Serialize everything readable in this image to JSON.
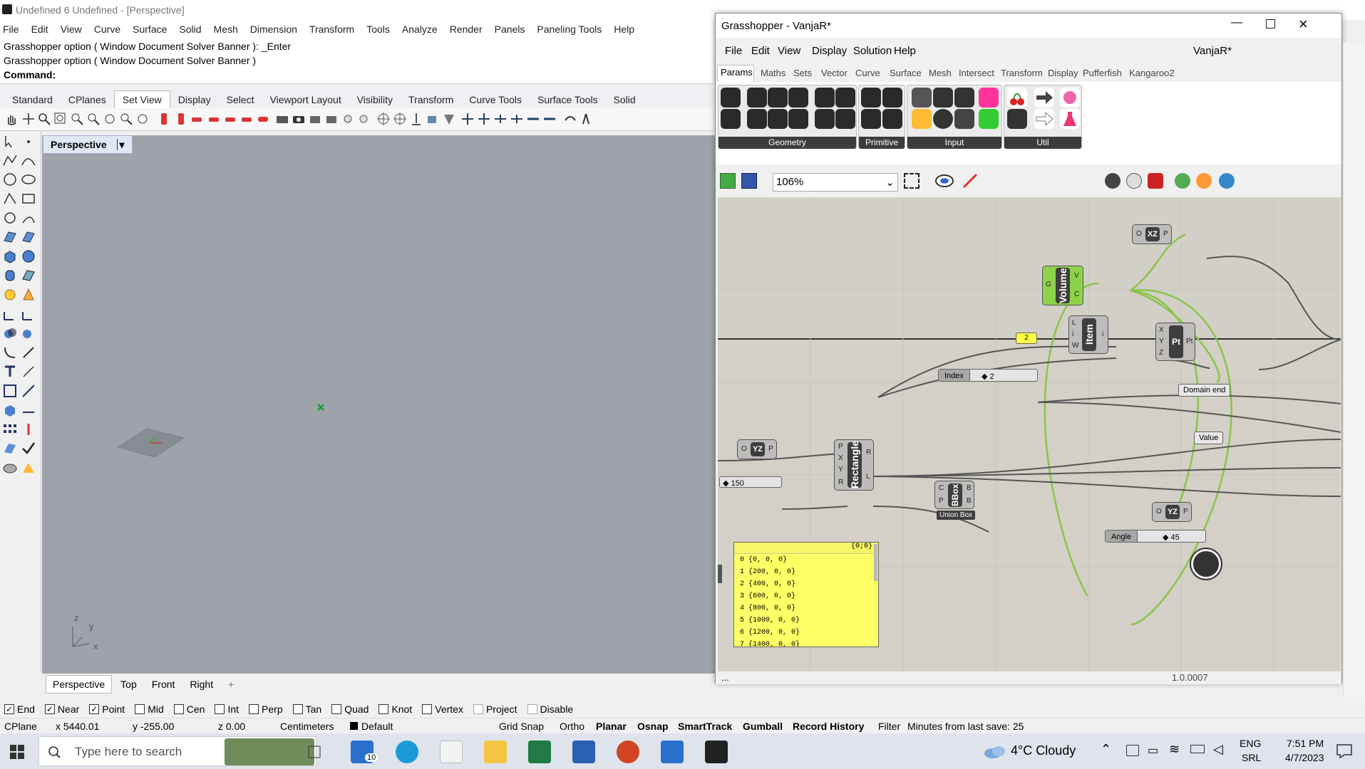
{
  "rhino": {
    "title": "Undefined 6 Undefined - [Perspective]",
    "menu": [
      "File",
      "Edit",
      "View",
      "Curve",
      "Surface",
      "Solid",
      "Mesh",
      "Dimension",
      "Transform",
      "Tools",
      "Analyze",
      "Render",
      "Panels",
      "Paneling Tools",
      "Help"
    ],
    "command_history": [
      "Grasshopper option ( Window  Document  Solver  Banner ): _Enter",
      "Grasshopper option ( Window  Document  Solver  Banner )"
    ],
    "command_prompt": "Command:",
    "toolbar_tabs": [
      "Standard",
      "CPlanes",
      "Set View",
      "Display",
      "Select",
      "Viewport Layout",
      "Visibility",
      "Transform",
      "Curve Tools",
      "Surface Tools",
      "Solid"
    ],
    "active_toolbar_tab": "Set View",
    "viewport_label": "Perspective",
    "axis": {
      "x": "x",
      "y": "y",
      "z": "z"
    },
    "viewport_tabs": [
      "Perspective",
      "Top",
      "Front",
      "Right"
    ],
    "add_tab": "+",
    "osnaps": [
      {
        "label": "End",
        "checked": true
      },
      {
        "label": "Near",
        "checked": true
      },
      {
        "label": "Point",
        "checked": true
      },
      {
        "label": "Mid",
        "checked": false
      },
      {
        "label": "Cen",
        "checked": false
      },
      {
        "label": "Int",
        "checked": false
      },
      {
        "label": "Perp",
        "checked": false
      },
      {
        "label": "Tan",
        "checked": false
      },
      {
        "label": "Quad",
        "checked": false
      },
      {
        "label": "Knot",
        "checked": false
      },
      {
        "label": "Vertex",
        "checked": false
      },
      {
        "label": "Project",
        "checked": false
      },
      {
        "label": "Disable",
        "checked": false
      }
    ],
    "status": {
      "cplane": "CPlane",
      "x": "x 5440.01",
      "y": "y -255.00",
      "z": "z 0.00",
      "units": "Centimeters",
      "layer": "Default",
      "grid_snap": "Grid Snap",
      "ortho": "Ortho",
      "planar": "Planar",
      "osnap": "Osnap",
      "smarttrack": "SmartTrack",
      "gumball": "Gumball",
      "record_history": "Record History",
      "filter": "Filter",
      "minutes": "Minutes from last save: 25"
    }
  },
  "grasshopper": {
    "title": "Grasshopper - VanjaR*",
    "menu": [
      "File",
      "Edit",
      "View",
      "Display",
      "Solution",
      "Help"
    ],
    "doc_name": "VanjaR*",
    "tabs": [
      "Params",
      "Maths",
      "Sets",
      "Vector",
      "Curve",
      "Surface",
      "Mesh",
      "Intersect",
      "Transform",
      "Display",
      "Pufferfish",
      "Kangaroo2"
    ],
    "active_tab": "Params",
    "ribbon_groups": [
      "Geometry",
      "Primitive",
      "Input",
      "Util"
    ],
    "zoom": "106%",
    "version": "1.0.0007",
    "footer_dots": "...",
    "components": {
      "volume": {
        "name": "Volume",
        "in": [
          "G"
        ],
        "out": [
          "V",
          "C"
        ]
      },
      "xz": {
        "name": "XZ",
        "in": [
          "O"
        ],
        "out": [
          "P"
        ]
      },
      "item": {
        "name": "Item",
        "in": [
          "L",
          "i",
          "W"
        ],
        "out": [
          "i"
        ]
      },
      "pt": {
        "name": "Pt",
        "in": [
          "X",
          "Y",
          "Z"
        ],
        "out": [
          "Pt"
        ]
      },
      "yz1": {
        "name": "YZ",
        "in": [
          "O"
        ],
        "out": [
          "P"
        ]
      },
      "rectangle": {
        "name": "Rectangle",
        "in": [
          "P",
          "X",
          "Y",
          "R"
        ],
        "out": [
          "R",
          "L"
        ]
      },
      "bbox": {
        "name": "BBox",
        "in": [
          "C",
          "P"
        ],
        "out": [
          "B",
          "B"
        ],
        "caption": "Union Box"
      },
      "yz2": {
        "name": "YZ",
        "in": [
          "O"
        ],
        "out": [
          "P"
        ]
      }
    },
    "panel": {
      "header": "{0;0}",
      "rows": [
        "0 {0, 0, 0}",
        "1 {200, 0, 0}",
        "2 {400, 0, 0}",
        "3 {600, 0, 0}",
        "4 {800, 0, 0}",
        "5 {1000, 0, 0}",
        "6 {1200, 0, 0}",
        "7 {1400, 0, 0}"
      ]
    },
    "number_2": "2",
    "index_slider": {
      "label": "Index",
      "value": "◆ 2"
    },
    "slider_150": "◆ 150",
    "angle_slider": {
      "label": "Angle",
      "value": "◆ 45"
    },
    "tags": {
      "domain_end": "Domain end",
      "value": "Value"
    }
  },
  "taskbar": {
    "search_placeholder": "Type here to search",
    "mail_badge": "10",
    "weather": "4°C  Cloudy",
    "lang": "ENG",
    "layout": "SRL",
    "time": "7:51 PM",
    "date": "4/7/2023"
  }
}
